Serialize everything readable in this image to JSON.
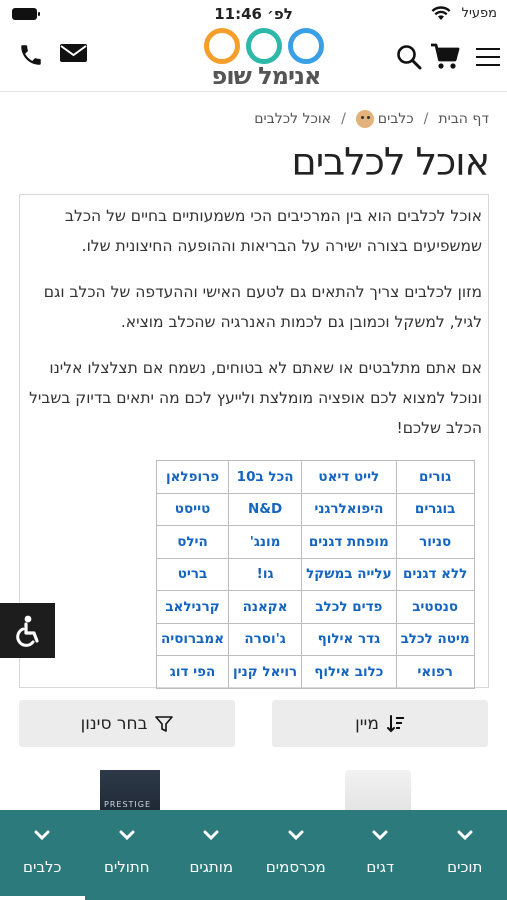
{
  "status_bar": {
    "time": "11:46 לפ׳",
    "carrier": "מפעיל"
  },
  "header": {
    "logo_text": "אנימל שופ",
    "logo_colors": [
      "#f59e2b",
      "#2eb8a9",
      "#3aa0e6"
    ],
    "icons": [
      "phone-icon",
      "mail-icon",
      "search-icon",
      "cart-icon",
      "menu-icon"
    ]
  },
  "breadcrumb": {
    "home": "דף הבית",
    "dogs": "כלבים",
    "current": "אוכל לכלבים"
  },
  "page_title": "אוכל לכלבים",
  "content": {
    "paragraphs": [
      "אוכל לכלבים הוא בין המרכיבים הכי משמעותיים בחיים של הכלב שמשפיעים בצורה ישירה על הבריאות וההופעה החיצונית שלו.",
      "מזון לכלבים צריך להתאים גם לטעם האישי וההעדפה של הכלב וגם לגיל, למשקל וכמובן גם לכמות האנרגיה שהכלב מוציא.",
      "אם אתם מתלבטים או שאתם לא בטוחים, נשמח אם תצלצלו אלינו ונוכל למצוא לכם אופציה מומלצת ולייעץ לכם מה יתאים בדיוק בשביל הכלב שלכם!"
    ],
    "links_table": [
      [
        "גורים",
        "לייט דיאט",
        "הכל ב10",
        "פרופלאן"
      ],
      [
        "בוגרים",
        "היפואלרגני",
        "N&D",
        "טייסט"
      ],
      [
        "סניור",
        "מופחת דגנים",
        "מונג'",
        "הילס"
      ],
      [
        "ללא דגנים",
        "עלייה במשקל",
        "גו!",
        "בריט"
      ],
      [
        "סנסטיב",
        "פדים לכלב",
        "אקאנה",
        "קרנילאב"
      ],
      [
        "מיטה לכלב",
        "גדר אילוף",
        "ג'וסרה",
        "אמברוסיה"
      ],
      [
        "רפואי",
        "כלוב אילוף",
        "רויאל קנין",
        "הפי דוג"
      ]
    ]
  },
  "actions": {
    "sort_label": "מיין",
    "filter_label": "בחר סינון"
  },
  "products": {
    "first_label": "PRESTIGE"
  },
  "bottom_nav": {
    "items": [
      "תוכים",
      "דגים",
      "מכרסמים",
      "מותגים",
      "חתולים",
      "כלבים"
    ],
    "active": "כלבים",
    "color": "#2c7a7b"
  }
}
